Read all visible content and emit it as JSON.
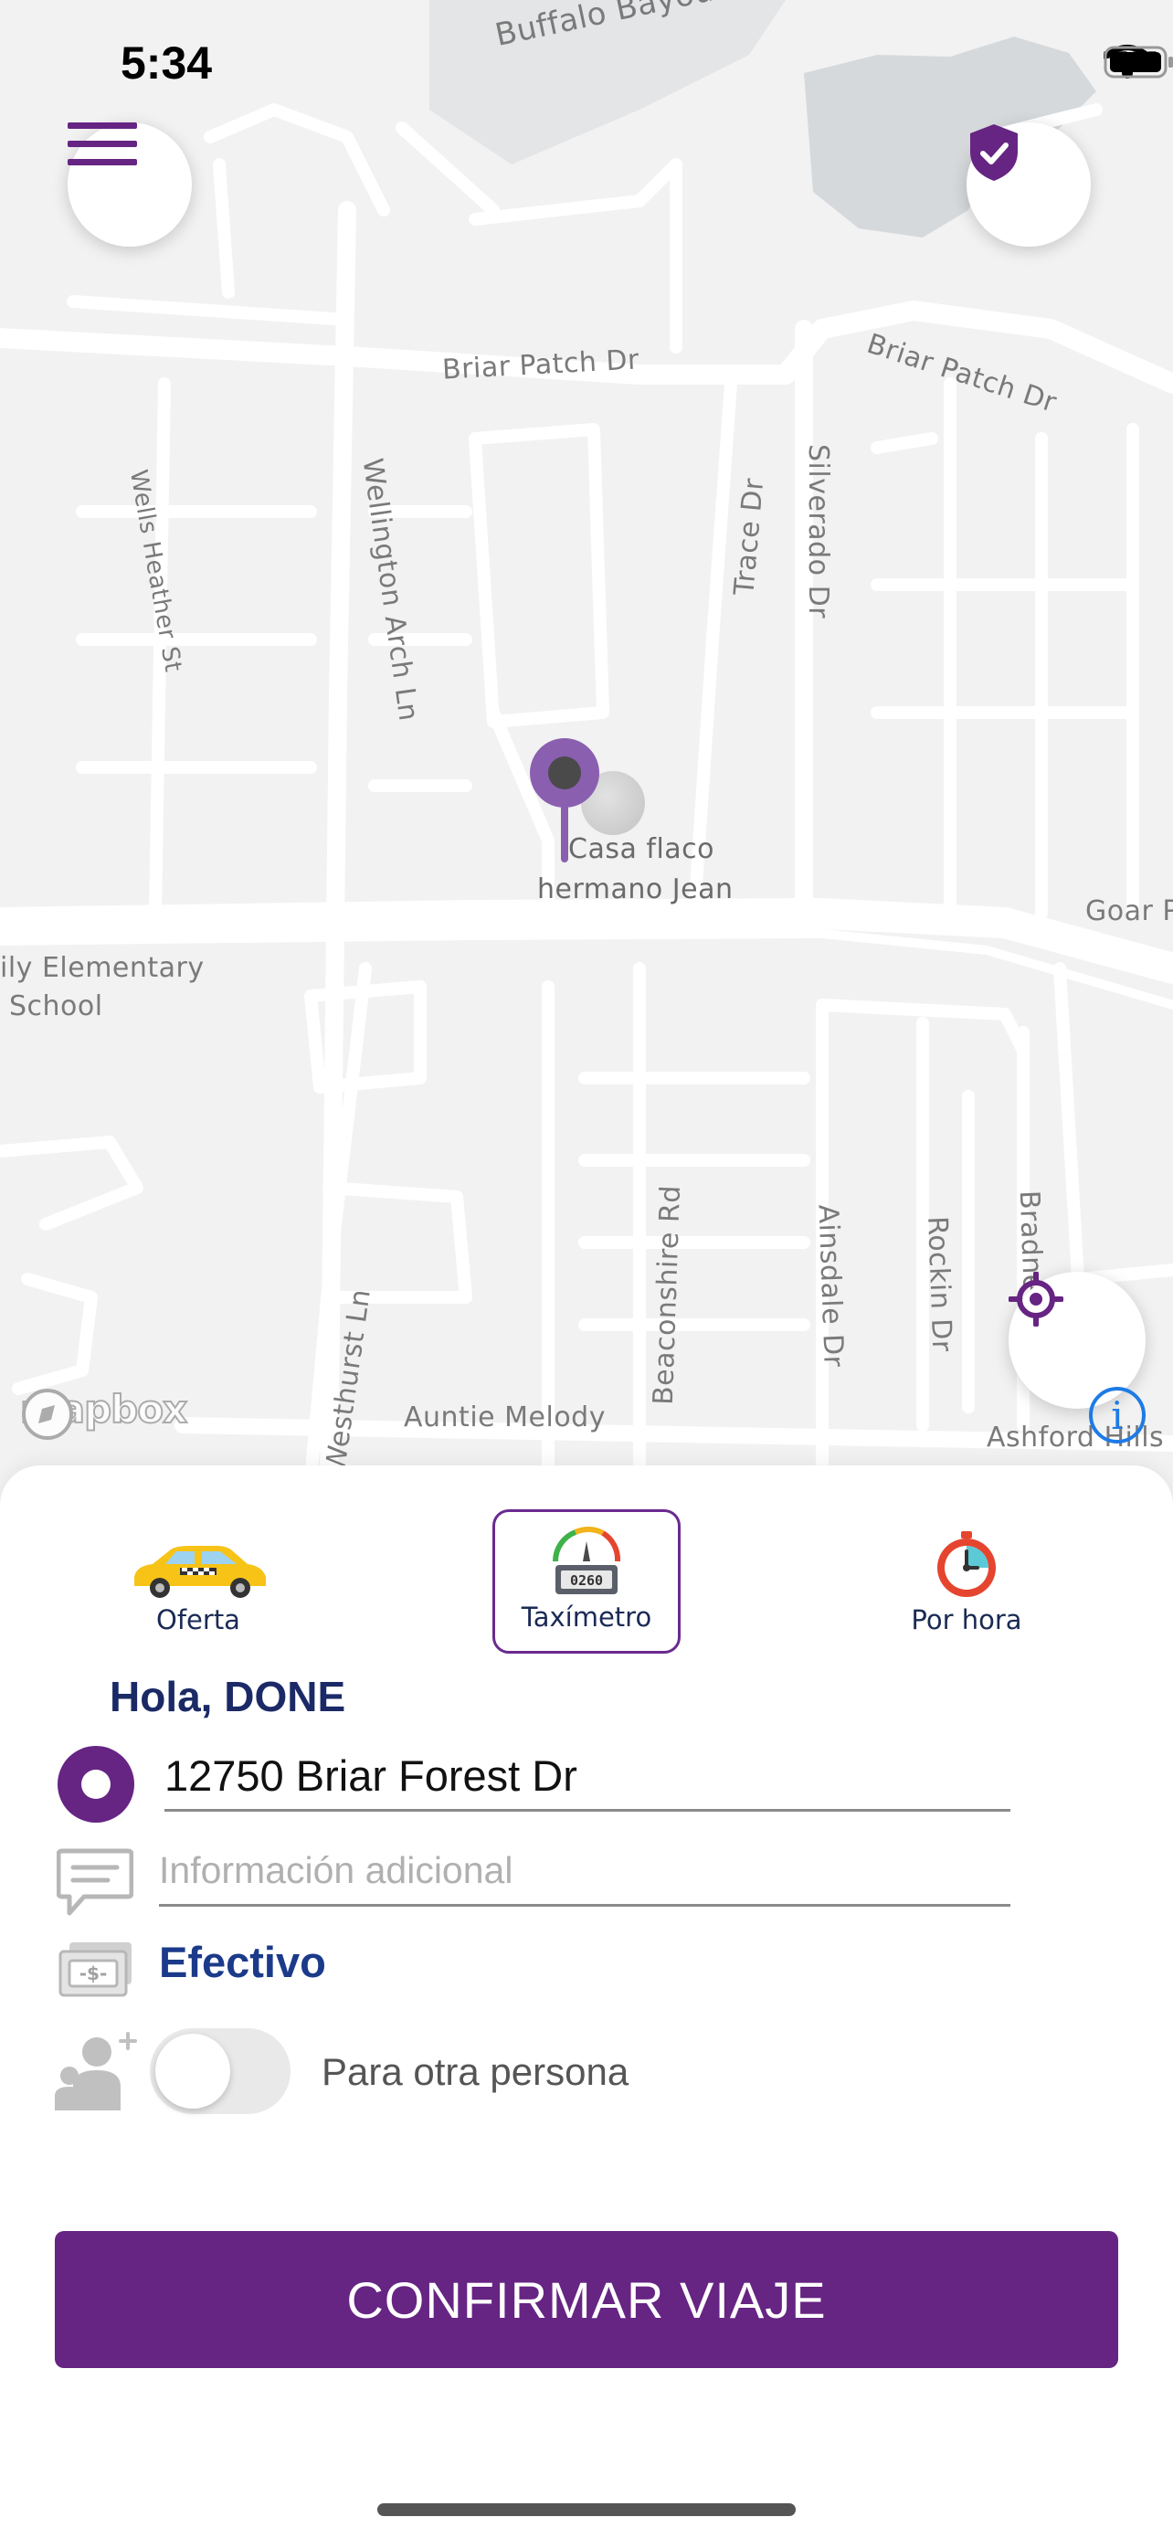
{
  "status_bar": {
    "time": "5:34"
  },
  "map": {
    "labels": {
      "buffalo_bayou": "Buffalo Bayou",
      "briar_patch_dr": "Briar Patch Dr",
      "briar_patch_dr_2": "Briar Patch Dr",
      "wells_heather_st": "Wells Heather St",
      "wellington_arch_ln": "Wellington Arch Ln",
      "trace_dr": "Trace Dr",
      "silverado_dr": "Silverado Dr",
      "goar": "Goar P",
      "school_line1": "ily Elementary",
      "school_line2": "School",
      "beaconshire_rd": "Beaconshire Rd",
      "ainsdale_dr": "Ainsdale Dr",
      "rockin_dr": "Rockin Dr",
      "bradney": "Bradney",
      "westhurst_ln": "Westhurst Ln",
      "auntie_melody": "Auntie Melody",
      "ashford_hills": "Ashford Hills"
    },
    "poi": {
      "line1": "Casa flaco",
      "line2": "hermano Jean"
    },
    "attribution": "mapbox"
  },
  "modes": [
    {
      "label": "Oferta",
      "icon": "taxi-icon"
    },
    {
      "label": "Taxímetro",
      "icon": "taximeter-icon",
      "active": true
    },
    {
      "label": "Por hora",
      "icon": "stopwatch-icon"
    }
  ],
  "form": {
    "greeting": "Hola, DONE",
    "address": "12750 Briar Forest Dr",
    "extra_placeholder": "Información adicional",
    "payment": "Efectivo",
    "other_person": "Para otra persona",
    "other_person_enabled": false
  },
  "confirm_label": "CONFIRMAR VIAJE",
  "colors": {
    "primary": "#662483",
    "navy": "#1b2a66"
  }
}
